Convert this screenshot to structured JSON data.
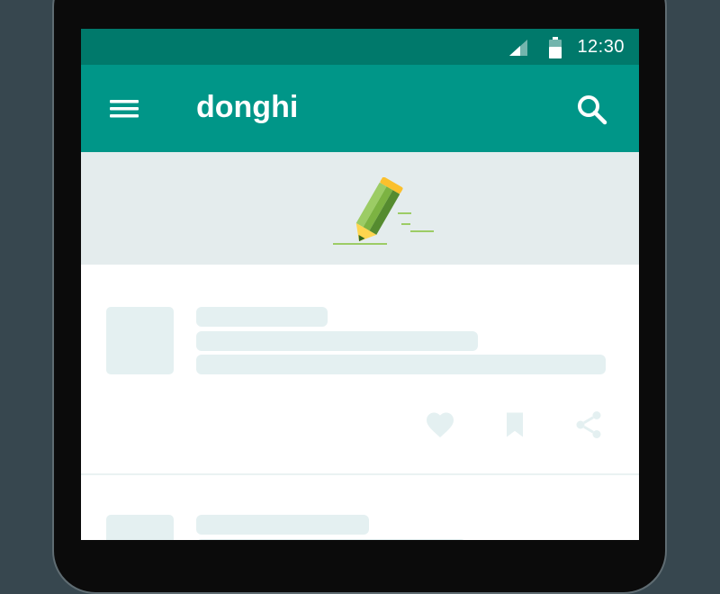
{
  "status_bar": {
    "time": "12:30",
    "icons": [
      "signal-icon",
      "battery-icon"
    ]
  },
  "app_bar": {
    "title": "donghi",
    "left_icon": "menu-icon",
    "right_icon": "search-icon"
  },
  "banner": {
    "illustration": "pencil-icon"
  },
  "card": {
    "actions": [
      "heart-icon",
      "bookmark-icon",
      "share-icon"
    ]
  },
  "colors": {
    "status_bar": "#00796b",
    "app_bar": "#009688",
    "banner_bg": "#e4eced",
    "placeholder": "#e4f0f1",
    "device_bg": "#37474f"
  }
}
